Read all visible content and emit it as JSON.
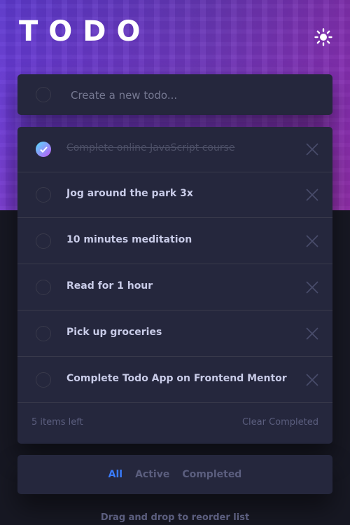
{
  "app": {
    "title": "TODO"
  },
  "theme_toggle": {
    "icon": "sun-icon"
  },
  "new_todo": {
    "placeholder": "Create a new todo..."
  },
  "todos": [
    {
      "text": "Complete online JavaScript course",
      "completed": true
    },
    {
      "text": "Jog around the park 3x",
      "completed": false
    },
    {
      "text": "10 minutes meditation",
      "completed": false
    },
    {
      "text": "Read for 1 hour",
      "completed": false
    },
    {
      "text": "Pick up groceries",
      "completed": false
    },
    {
      "text": "Complete Todo App on Frontend Mentor",
      "completed": false
    }
  ],
  "footer": {
    "items_left": "5 items left",
    "clear_label": "Clear Completed"
  },
  "filters": {
    "all": "All",
    "active": "Active",
    "completed": "Completed",
    "selected": "all"
  },
  "hint": "Drag and drop to reorder list",
  "colors": {
    "background": "#171823",
    "card": "#25273d",
    "accent": "#3a7cfd",
    "check_gradient_start": "#55ddff",
    "check_gradient_end": "#c058f3"
  }
}
